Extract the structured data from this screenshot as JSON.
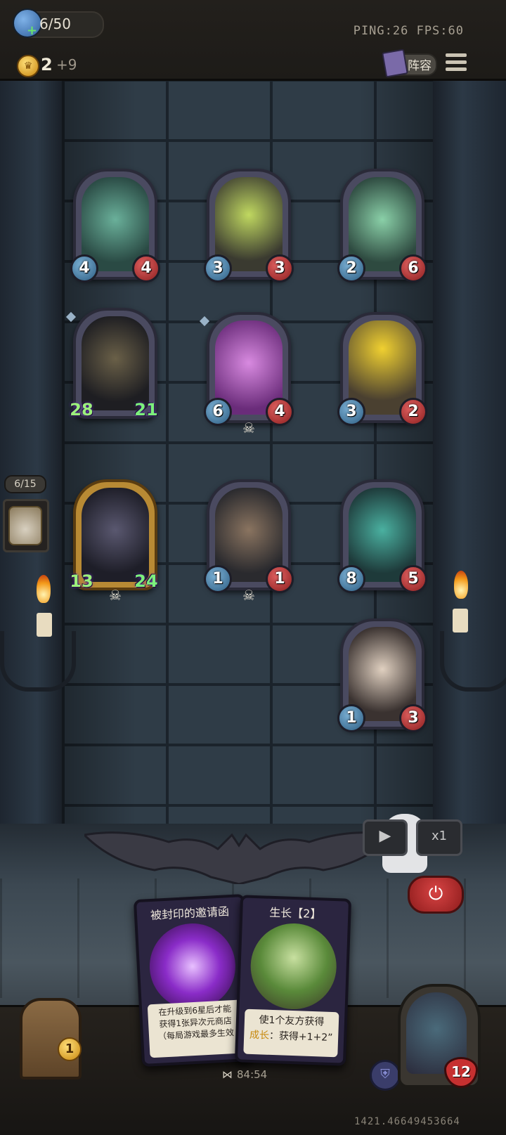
{
  "topbar": {
    "player_count": "6/50",
    "ping_fps": "PING:26   FPS:60",
    "gold": "2",
    "gold_income": "+9",
    "lineup_label": "阵容"
  },
  "side_panel": {
    "count": "6/15"
  },
  "board": {
    "cards": [
      {
        "attack": "4",
        "health": "4",
        "skull": false,
        "diamond": false,
        "gold": false,
        "big": false
      },
      {
        "attack": "3",
        "health": "3",
        "skull": false,
        "diamond": false,
        "gold": false,
        "big": false
      },
      {
        "attack": "2",
        "health": "6",
        "skull": false,
        "diamond": false,
        "gold": false,
        "big": false
      },
      {
        "attack": "28",
        "health": "21",
        "skull": false,
        "diamond": true,
        "gold": false,
        "big": true
      },
      {
        "attack": "6",
        "health": "4",
        "skull": true,
        "diamond": true,
        "gold": false,
        "big": false
      },
      {
        "attack": "3",
        "health": "2",
        "skull": false,
        "diamond": false,
        "gold": false,
        "big": false
      },
      {
        "attack": "13",
        "health": "24",
        "skull": true,
        "diamond": false,
        "gold": true,
        "big": true
      },
      {
        "attack": "1",
        "health": "1",
        "skull": true,
        "diamond": false,
        "gold": false,
        "big": false
      },
      {
        "attack": "8",
        "health": "5",
        "skull": false,
        "diamond": false,
        "gold": false,
        "big": false
      },
      {
        "attack": "1",
        "health": "3",
        "skull": false,
        "diamond": false,
        "gold": false,
        "big": false
      }
    ]
  },
  "controls": {
    "play_icon": "▶",
    "speed_label": "x1",
    "power_icon": "⏻"
  },
  "hand": [
    {
      "title": "被封印的邀请函",
      "desc_line1": "在升级到6星后才能",
      "desc_line2": "获得1张异次元商店",
      "desc_line3": "（每局游戏最多生效"
    },
    {
      "title": "生长【2】",
      "stars": "★★",
      "desc_line1": "使1个友方获得",
      "desc_keyword": "成长",
      "desc_line2": "：获得+1+2”"
    }
  ],
  "bottom": {
    "chest_level": "1",
    "timer": "84:54",
    "hero_health": "12",
    "uid": "1421.46649453664"
  }
}
